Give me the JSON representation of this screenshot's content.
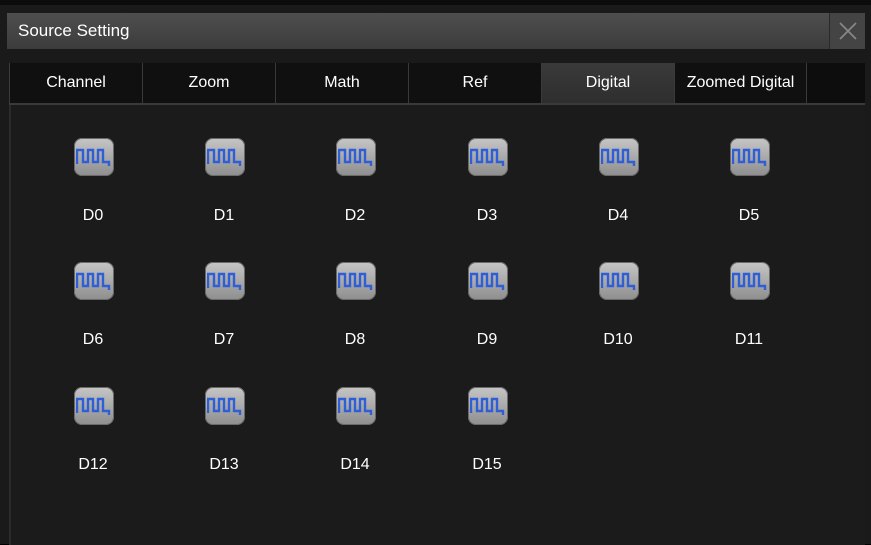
{
  "dialog": {
    "title": "Source Setting",
    "close_icon": "close-icon"
  },
  "tabs": [
    {
      "label": "Channel",
      "active": false
    },
    {
      "label": "Zoom",
      "active": false
    },
    {
      "label": "Math",
      "active": false
    },
    {
      "label": "Ref",
      "active": false
    },
    {
      "label": "Digital",
      "active": true
    },
    {
      "label": "Zoomed Digital",
      "active": false
    }
  ],
  "digital_channels": [
    {
      "label": "D0",
      "icon": "digital-waveform-icon"
    },
    {
      "label": "D1",
      "icon": "digital-waveform-icon"
    },
    {
      "label": "D2",
      "icon": "digital-waveform-icon"
    },
    {
      "label": "D3",
      "icon": "digital-waveform-icon"
    },
    {
      "label": "D4",
      "icon": "digital-waveform-icon"
    },
    {
      "label": "D5",
      "icon": "digital-waveform-icon"
    },
    {
      "label": "D6",
      "icon": "digital-waveform-icon"
    },
    {
      "label": "D7",
      "icon": "digital-waveform-icon"
    },
    {
      "label": "D8",
      "icon": "digital-waveform-icon"
    },
    {
      "label": "D9",
      "icon": "digital-waveform-icon"
    },
    {
      "label": "D10",
      "icon": "digital-waveform-icon"
    },
    {
      "label": "D11",
      "icon": "digital-waveform-icon"
    },
    {
      "label": "D12",
      "icon": "digital-waveform-icon"
    },
    {
      "label": "D13",
      "icon": "digital-waveform-icon"
    },
    {
      "label": "D14",
      "icon": "digital-waveform-icon"
    },
    {
      "label": "D15",
      "icon": "digital-waveform-icon"
    }
  ],
  "colors": {
    "waveform": "#2f5fd6",
    "background": "#1b1b1b",
    "active_tab": "#353535"
  }
}
